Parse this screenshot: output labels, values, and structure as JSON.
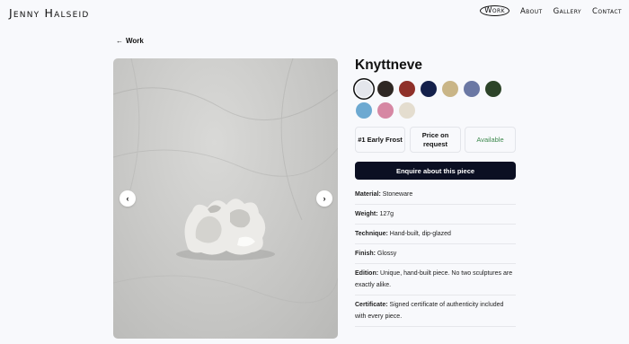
{
  "site": {
    "logo": "Jenny Halseid"
  },
  "nav": [
    {
      "label": "Work",
      "active": true
    },
    {
      "label": "About",
      "active": false
    },
    {
      "label": "Gallery",
      "active": false
    },
    {
      "label": "Contact",
      "active": false
    }
  ],
  "back_link": "Work",
  "product": {
    "title": "Knyttneve",
    "swatches": [
      "#e4e6ec",
      "#2e2723",
      "#8f3029",
      "#14204b",
      "#c9b587",
      "#6b78a4",
      "#2d4429",
      "#6da9d1",
      "#d687a3",
      "#e4ddcf"
    ],
    "selected_swatch_index": 0,
    "tiles": [
      "#1 Early Frost",
      "Price on request",
      "Available"
    ],
    "enquire_label": "Enquire about this piece",
    "specs": [
      {
        "label": "Material:",
        "value": "Stoneware"
      },
      {
        "label": "Weight:",
        "value": "127g"
      },
      {
        "label": "Technique:",
        "value": "Hand-built, dip-glazed"
      },
      {
        "label": "Finish:",
        "value": "Glossy"
      },
      {
        "label": "Edition:",
        "value": "Unique, hand-built piece. No two sculptures are exactly alike."
      },
      {
        "label": "Certificate:",
        "value": "Signed certificate of authenticity included with every piece."
      }
    ]
  },
  "icons": {
    "back": "arrow-left-icon",
    "prev": "chevron-left-icon",
    "next": "chevron-right-icon"
  },
  "colors": {
    "accent_dark": "#0b0f22",
    "available_green": "#3f8a4f",
    "background": "#f8f9fc"
  }
}
